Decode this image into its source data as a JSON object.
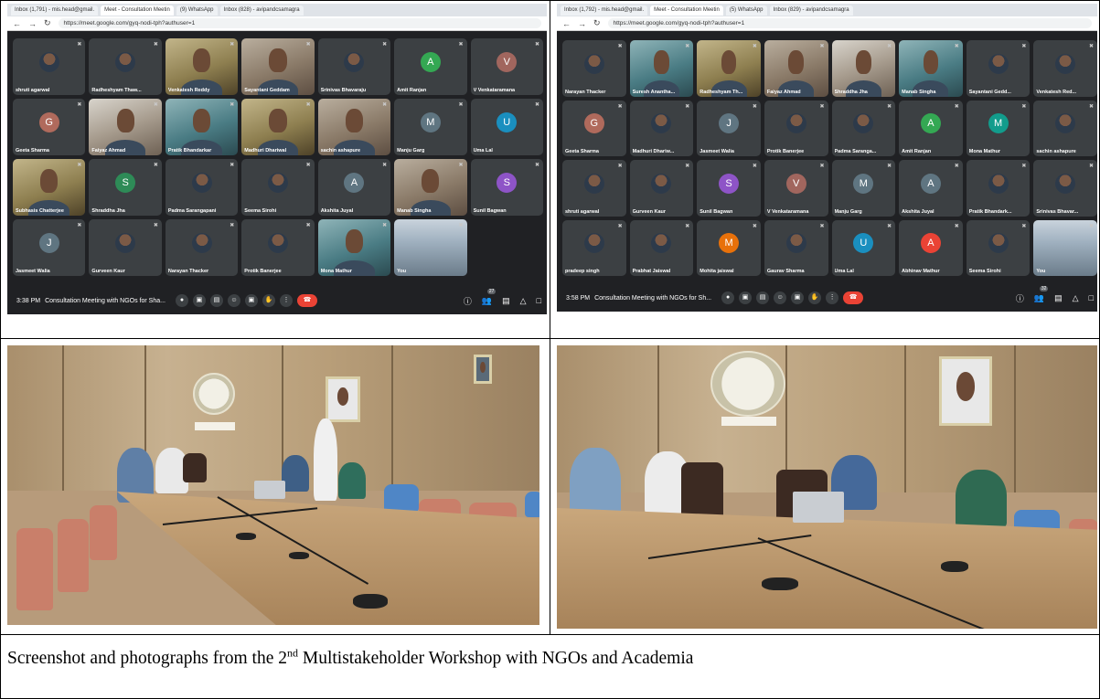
{
  "caption": {
    "before": "Screenshot and photographs from the 2",
    "sup": "nd",
    "after": " Multistakeholder Workshop with NGOs and Academia"
  },
  "left_screenshot": {
    "tabs": [
      "Inbox (1,791) - mis.head@gmail.",
      "Meet - Consultation Meetin",
      "(9) WhatsApp",
      "Inbox (828) - avipandcsamagra"
    ],
    "url": "https://meet.google.com/gyq-nodi-tph?authuser=1",
    "time": "3:38 PM",
    "meeting_title": "Consultation Meeting with NGOs for Sha...",
    "participant_count": "27",
    "participants": [
      {
        "name": "shruti agarwal",
        "kind": "photo"
      },
      {
        "name": "Radheshyam Thaw...",
        "kind": "photo"
      },
      {
        "name": "Venkatesh Reddy",
        "kind": "video"
      },
      {
        "name": "Sayantani Geddam",
        "kind": "video"
      },
      {
        "name": "Srinivas Bhavaraju",
        "kind": "photo"
      },
      {
        "name": "Amit Ranjan",
        "kind": "letter",
        "letter": "A",
        "color": "#34a853"
      },
      {
        "name": "V Venkataramana",
        "kind": "letter",
        "letter": "V",
        "color": "#a1665e"
      },
      {
        "name": "Geeta Sharma",
        "kind": "letter",
        "letter": "G",
        "color": "#b06a5c"
      },
      {
        "name": "Faiyaz Ahmad",
        "kind": "video"
      },
      {
        "name": "Pratik Bhandarkar",
        "kind": "video"
      },
      {
        "name": "Madhuri Dhariwal",
        "kind": "video"
      },
      {
        "name": "sachin ashapure",
        "kind": "video"
      },
      {
        "name": "Manju Garg",
        "kind": "letter",
        "letter": "M",
        "color": "#5f7581"
      },
      {
        "name": "Uma Lal",
        "kind": "letter",
        "letter": "U",
        "color": "#1a8fbf"
      },
      {
        "name": "Subhasis Chatterjee",
        "kind": "video"
      },
      {
        "name": "Shraddha Jha",
        "kind": "letter",
        "letter": "S",
        "color": "#2e8b57"
      },
      {
        "name": "Padma Sarangapani",
        "kind": "photo"
      },
      {
        "name": "Seema Sirohi",
        "kind": "photo"
      },
      {
        "name": "Akshita Juyal",
        "kind": "letter",
        "letter": "A",
        "color": "#5f7581"
      },
      {
        "name": "Manab Singha",
        "kind": "video"
      },
      {
        "name": "Sunil Bagwan",
        "kind": "letter",
        "letter": "S",
        "color": "#8e54c7"
      },
      {
        "name": "Jasmeet Walia",
        "kind": "letter",
        "letter": "J",
        "color": "#5f7581"
      },
      {
        "name": "Gurveen Kaur",
        "kind": "photo"
      },
      {
        "name": "Narayan Thacker",
        "kind": "photo"
      },
      {
        "name": "Protik Banerjee",
        "kind": "photo"
      },
      {
        "name": "Mona Mathur",
        "kind": "video"
      },
      {
        "name": "You",
        "kind": "room"
      }
    ]
  },
  "right_screenshot": {
    "tabs": [
      "Inbox (1,792) - mis.head@gmail.",
      "Meet - Consultation Meetin",
      "(5) WhatsApp",
      "Inbox (829) - avipandcsamagra"
    ],
    "url": "https://meet.google.com/gyq-nodi-tph?authuser=1",
    "time": "3:58 PM",
    "meeting_title": "Consultation Meeting with NGOs for Sh...",
    "participant_count": "32",
    "participants": [
      {
        "name": "Narayan Thacker",
        "kind": "photo"
      },
      {
        "name": "Suresh Anantha...",
        "kind": "video"
      },
      {
        "name": "Radheshyam Th...",
        "kind": "video"
      },
      {
        "name": "Faiyaz Ahmad",
        "kind": "video"
      },
      {
        "name": "Shraddha Jha",
        "kind": "video"
      },
      {
        "name": "Manab Singha",
        "kind": "video"
      },
      {
        "name": "Sayantani Gedd...",
        "kind": "photo"
      },
      {
        "name": "Venkatesh Red...",
        "kind": "photo"
      },
      {
        "name": "Geeta Sharma",
        "kind": "letter",
        "letter": "G",
        "color": "#b06a5c"
      },
      {
        "name": "Madhuri Dhariw...",
        "kind": "photo"
      },
      {
        "name": "Jasmeet Walia",
        "kind": "letter",
        "letter": "J",
        "color": "#5f7581"
      },
      {
        "name": "Protik Banerjee",
        "kind": "photo"
      },
      {
        "name": "Padma Saranga...",
        "kind": "photo"
      },
      {
        "name": "Amit Ranjan",
        "kind": "letter",
        "letter": "A",
        "color": "#34a853"
      },
      {
        "name": "Mona Mathur",
        "kind": "letter",
        "letter": "M",
        "color": "#129c8c"
      },
      {
        "name": "sachin ashapure",
        "kind": "photo"
      },
      {
        "name": "shruti agarwal",
        "kind": "photo"
      },
      {
        "name": "Gurveen Kaur",
        "kind": "photo"
      },
      {
        "name": "Sunil Bagwan",
        "kind": "letter",
        "letter": "S",
        "color": "#8e54c7"
      },
      {
        "name": "V Venkataramana",
        "kind": "letter",
        "letter": "V",
        "color": "#a1665e"
      },
      {
        "name": "Manju Garg",
        "kind": "letter",
        "letter": "M",
        "color": "#5f7581"
      },
      {
        "name": "Akshita Juyal",
        "kind": "letter",
        "letter": "A",
        "color": "#5f7581"
      },
      {
        "name": "Pratik Bhandark...",
        "kind": "photo"
      },
      {
        "name": "Srinivas Bhavar...",
        "kind": "photo"
      },
      {
        "name": "pradeep singh",
        "kind": "photo"
      },
      {
        "name": "Prabhat Jaiswal",
        "kind": "photo"
      },
      {
        "name": "Mohita jaiswal",
        "kind": "letter",
        "letter": "M",
        "color": "#e8710a"
      },
      {
        "name": "Gaurav Sharma",
        "kind": "photo"
      },
      {
        "name": "Uma Lal",
        "kind": "letter",
        "letter": "U",
        "color": "#1a8fbf"
      },
      {
        "name": "Abhinav Mathur",
        "kind": "letter",
        "letter": "A",
        "color": "#ea4335"
      },
      {
        "name": "Seema Sirohi",
        "kind": "photo"
      },
      {
        "name": "You",
        "kind": "room"
      }
    ]
  }
}
